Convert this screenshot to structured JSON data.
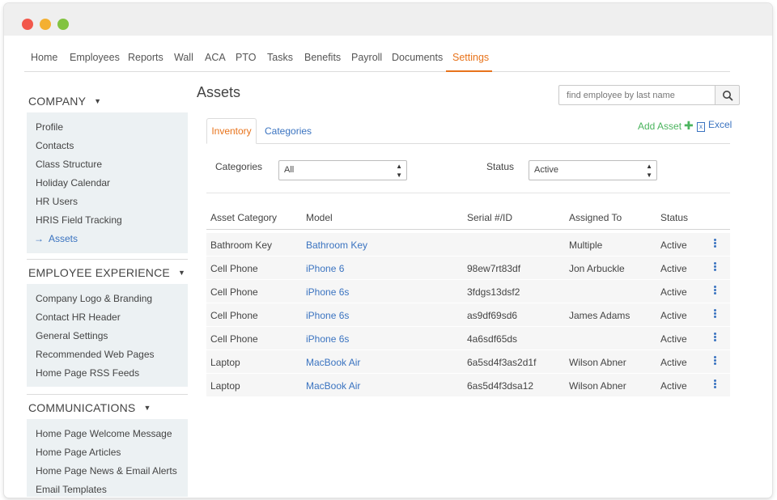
{
  "nav": {
    "items": [
      "Home",
      "Employees",
      "Reports",
      "Wall",
      "ACA",
      "PTO",
      "Tasks",
      "Benefits",
      "Payroll",
      "Documents",
      "Settings"
    ],
    "active": "Settings"
  },
  "sidebar": {
    "sections": [
      {
        "title": "COMPANY",
        "items": [
          "Profile",
          "Contacts",
          "Class Structure",
          "Holiday Calendar",
          "HR Users",
          "HRIS Field Tracking",
          "Assets"
        ],
        "active_item": "Assets"
      },
      {
        "title": "EMPLOYEE EXPERIENCE",
        "items": [
          "Company Logo & Branding",
          "Contact HR Header",
          "General Settings",
          "Recommended Web Pages",
          "Home Page RSS Feeds"
        ]
      },
      {
        "title": "COMMUNICATIONS",
        "items": [
          "Home Page Welcome Message",
          "Home Page Articles",
          "Home Page News & Email Alerts",
          "Email Templates"
        ]
      }
    ]
  },
  "main": {
    "title": "Assets",
    "search": {
      "placeholder": "find employee by last name"
    },
    "tabs": [
      "Inventory",
      "Categories"
    ],
    "active_tab": "Inventory",
    "actions": {
      "add_asset": "Add Asset",
      "excel": "Excel"
    },
    "filters": {
      "categories_label": "Categories",
      "categories_value": "All",
      "status_label": "Status",
      "status_value": "Active"
    },
    "table": {
      "columns": [
        "Asset Category",
        "Model",
        "Serial #/ID",
        "Assigned To",
        "Status"
      ],
      "rows": [
        [
          "Bathroom Key",
          "Bathroom Key",
          "",
          "Multiple",
          "Active"
        ],
        [
          "Cell Phone",
          "iPhone 6",
          "98ew7rt83df",
          "Jon Arbuckle",
          "Active"
        ],
        [
          "Cell Phone",
          "iPhone 6s",
          "3fdgs13dsf2",
          "",
          "Active"
        ],
        [
          "Cell Phone",
          "iPhone 6s",
          "as9df69sd6",
          "James Adams",
          "Active"
        ],
        [
          "Cell Phone",
          "iPhone 6s",
          "4a6sdf65ds",
          "",
          "Active"
        ],
        [
          "Laptop",
          "MacBook Air",
          "6a5sd4f3as2d1f",
          "Wilson Abner",
          "Active"
        ],
        [
          "Laptop",
          "MacBook Air",
          "6as5d4f3dsa12",
          "Wilson Abner",
          "Active"
        ]
      ]
    }
  },
  "colors": {
    "accent": "#e8731b",
    "link": "#3a73c0",
    "add": "#4bb45e",
    "sidebar_bg": "#ecf1f3"
  },
  "icons": [
    "search-icon",
    "plus-icon",
    "excel-icon",
    "arrow-right-icon",
    "caret-down-icon",
    "kebab-menu-icon",
    "select-arrows-icon"
  ]
}
